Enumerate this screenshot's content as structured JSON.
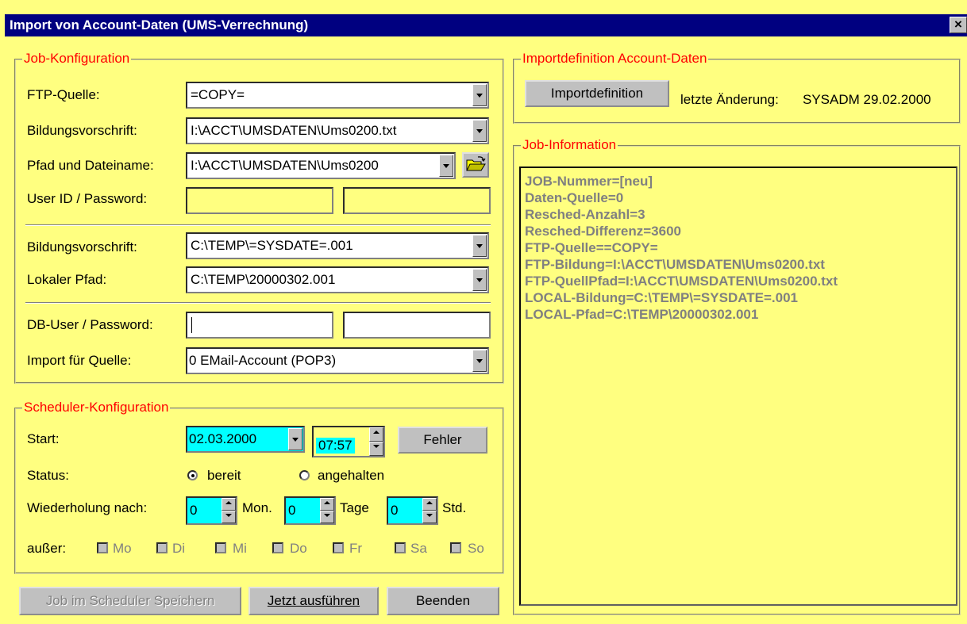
{
  "window": {
    "title": "Import von Account-Daten (UMS-Verrechnung)",
    "close_glyph": "×"
  },
  "job_config": {
    "title": "Job-Konfiguration",
    "ftp_quelle_label": "FTP-Quelle:",
    "ftp_quelle_value": "=COPY=",
    "bildung1_label": "Bildungsvorschrift:",
    "bildung1_value": "I:\\ACCT\\UMSDATEN\\Ums0200.txt",
    "pfad_label": "Pfad und Dateiname:",
    "pfad_value": "I:\\ACCT\\UMSDATEN\\Ums0200",
    "userid_label": "User ID / Password:",
    "userid_value": "",
    "password_value": "",
    "bildung2_label": "Bildungsvorschrift:",
    "bildung2_value": "C:\\TEMP\\=SYSDATE=.001",
    "lokal_label": "Lokaler Pfad:",
    "lokal_value": "C:\\TEMP\\20000302.001",
    "dbuser_label": "DB-User / Password:",
    "dbuser_value": "",
    "dbpass_value": "",
    "import_label": "Import für Quelle:",
    "import_value": "0 EMail-Account (POP3)"
  },
  "scheduler": {
    "title": "Scheduler-Konfiguration",
    "start_label": "Start:",
    "start_date": "02.03.2000",
    "start_time": "07:57",
    "fehler_button": "Fehler",
    "status_label": "Status:",
    "status_options": [
      "bereit",
      "angehalten"
    ],
    "status_selected": "bereit",
    "repeat_label": "Wiederholung nach:",
    "repeat_mon": "0",
    "repeat_mon_unit": "Mon.",
    "repeat_tage": "0",
    "repeat_tage_unit": "Tage",
    "repeat_std": "0",
    "repeat_std_unit": "Std.",
    "except_label": "außer:",
    "days": [
      "Mo",
      "Di",
      "Mi",
      "Do",
      "Fr",
      "Sa",
      "So"
    ]
  },
  "buttons": {
    "save": "Job im Scheduler Speichern",
    "run": "Jetzt ausführen",
    "quit": "Beenden"
  },
  "import_def": {
    "title": "Importdefinition Account-Daten",
    "button": "Importdefinition",
    "last_change_label": "letzte Änderung:",
    "last_change_value": "SYSADM 29.02.2000"
  },
  "job_info": {
    "title": "Job-Information",
    "lines": [
      "JOB-Nummer=[neu]",
      "Daten-Quelle=0",
      "Resched-Anzahl=3",
      "Resched-Differenz=3600",
      "FTP-Quelle==COPY=",
      "FTP-Bildung=I:\\ACCT\\UMSDATEN\\Ums0200.txt",
      "FTP-QuellPfad=I:\\ACCT\\UMSDATEN\\Ums0200.txt",
      "LOCAL-Bildung=C:\\TEMP\\=SYSDATE=.001",
      "LOCAL-Pfad=C:\\TEMP\\20000302.001"
    ]
  }
}
